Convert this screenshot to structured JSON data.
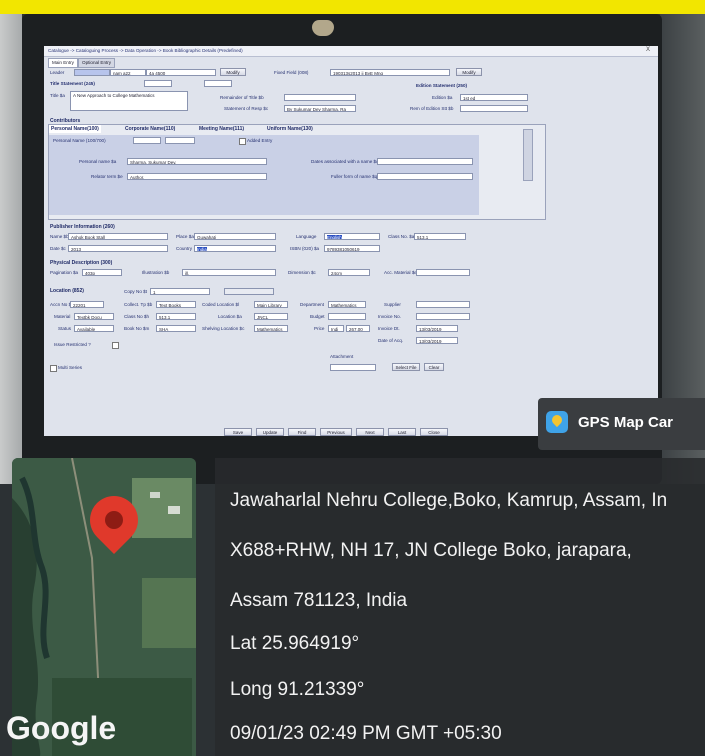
{
  "window": {
    "breadcrumb": "Catalogue -> Cataloguing Process -> Data Operation -> Book Bibliographic Details (Predefined)",
    "tabs": [
      "Main Entry",
      "Optional Entry"
    ],
    "close": "X"
  },
  "form": {
    "leader_label": "Leader",
    "leader_value": "nam a22",
    "leader_value2": "4a 4500",
    "modify": "Modify",
    "fixed_field_label": "Fixed Field (008)",
    "fixed_field_value": "190313s2013 ii ByE Mng",
    "title_statement_label": "Title Statement (245)",
    "title_sa_label": "Title $a",
    "title_sa_value": "A New Approach to College Mathematics",
    "remainder_label": "Remainder of Title $b",
    "resp_label": "Statement of Resp $c",
    "resp_value": "By Sukumar Dev Sharma, Ra",
    "edition_label": "Edition Statement (250)",
    "edition_sa_label": "Edition $a",
    "edition_sa_value": "1st ed",
    "rem_edition_label": "Rem of Edition Stt $b",
    "contributors_label": "Contributors",
    "contrib_tabs": [
      "Personal Name(100)",
      "Corporate Name(110)",
      "Meeting Name(111)",
      "Uniform Name(130)"
    ],
    "personal_name_700_label": "Personal Name (100/700)",
    "added_entry": "Added Entry",
    "personal_sa_label": "Personal name $a",
    "personal_sa_value": "Sharma, Sukumar Dev,",
    "relator_label": "Relator term $e",
    "relator_value": "Author.",
    "dates_label": "Dates associated with a name $d",
    "fuller_label": "Fuller form of name $q",
    "publisher_label": "Publisher Information (260)",
    "name_sb_label": "Name $b",
    "name_sb_value": "Ashok Book Stall",
    "place_label": "Place $a",
    "place_value": "Guwahati",
    "language_label": "Language",
    "language_value": "English",
    "class_no_label": "Class No. $a",
    "class_no_value": "513.1",
    "date_label": "Date $c",
    "date_value": "2013",
    "country_label": "Country",
    "country_value": "India",
    "isbn_label": "ISBN (020) $a",
    "isbn_value": "9789381050619",
    "physical_label": "Physical Description (300)",
    "pagination_label": "Pagination $a",
    "pagination_value": "403p",
    "illustration_label": "Illustration $b",
    "illustration_value": "ill.",
    "dimension_label": "Dimension $c",
    "dimension_value": "24cm",
    "acc_material_label": "Acc. Material $e",
    "location_label": "Location (852)",
    "copy_no_label": "Copy No $t",
    "copy_no_value": "1",
    "accn_no_label": "Accn No $p",
    "accn_no_value": "22201",
    "collect_label": "Collect. Tp $b",
    "collect_value": "Text Books",
    "coded_loc_label": "Coded Location $l",
    "coded_loc_value": "Main Library",
    "department_label": "Department",
    "department_value": "Mathematics",
    "supplier_label": "Supplier",
    "material_label": "Material",
    "material_value": "Textbk Docu",
    "class_no_h_label": "Class No $h",
    "class_no_h_value": "513.1",
    "location_sa_label": "Location $a",
    "location_sa_value": "JNCL",
    "budget_label": "Budget",
    "invoice_no_label": "Invoice No.",
    "status_label": "Status",
    "status_value": "Available",
    "book_no_label": "Book No $m",
    "book_no_value": "SHA",
    "shelving_label": "Shelving Location $c",
    "shelving_value": "Mathematics",
    "price_label": "Price",
    "price_currency": "Indi",
    "price_value": "267.00",
    "invoice_dt_label": "Invoice Dt.",
    "invoice_dt_value": "13/03/2019",
    "date_acq_label": "Date of Acq.",
    "date_acq_value": "13/03/2019",
    "issue_restricted_label": "Issue Restricted ?",
    "attachment_label": "Attachment",
    "select_file": "Select File",
    "clear": "Clear",
    "multi_series_label": "Multi Series",
    "bottom_buttons": [
      "Save",
      "Update",
      "Find",
      "Previous",
      "Next",
      "Last",
      "Close"
    ]
  },
  "overlay": {
    "badge_text": "GPS Map Car",
    "address_line1": "Jawaharlal Nehru College,Boko, Kamrup, Assam, In",
    "address_line2": "X688+RHW, NH 17, JN College Boko, jarapara,",
    "address_line3": "Assam 781123, India",
    "lat": "Lat 25.964919°",
    "long": "Long 91.21339°",
    "timestamp": "09/01/23 02:49 PM GMT +05:30",
    "map_brand": "Google"
  },
  "colors": {
    "banner": "#f2e600",
    "pin": "#e0392b",
    "form_bg": "#dfe3ec",
    "section_title": "#1f2a66"
  }
}
